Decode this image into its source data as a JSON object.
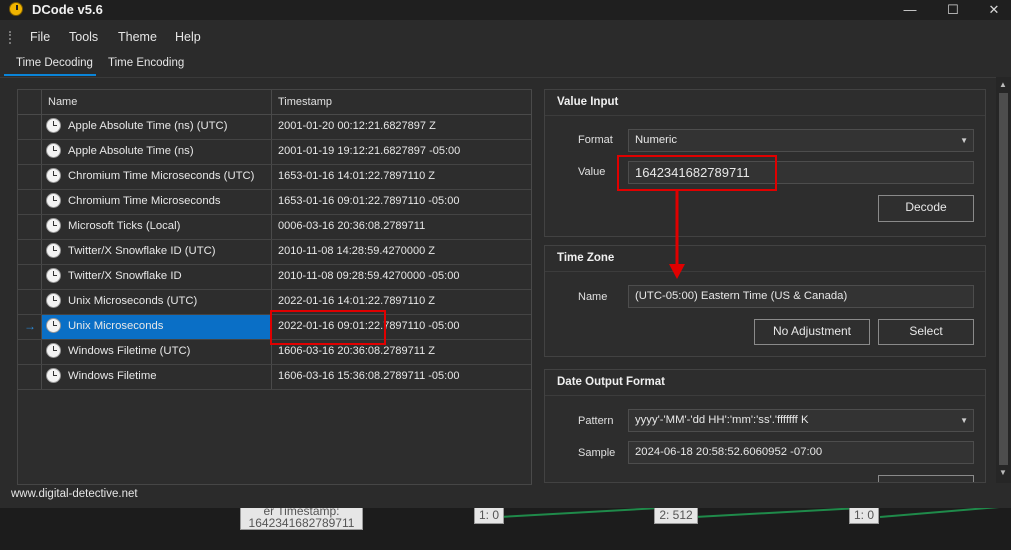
{
  "window": {
    "title": "DCode v5.6",
    "controls": {
      "minimize": "—",
      "maximize": "☐",
      "close": "✕"
    }
  },
  "menu": [
    "File",
    "Tools",
    "Theme",
    "Help"
  ],
  "tabs": [
    {
      "label": "Time Decoding",
      "active": true
    },
    {
      "label": "Time Encoding",
      "active": false
    }
  ],
  "grid": {
    "columns": [
      "Name",
      "Timestamp"
    ],
    "rows": [
      {
        "name": "Apple Absolute Time (ns) (UTC)",
        "timestamp": "2001-01-20 00:12:21.6827897 Z"
      },
      {
        "name": "Apple Absolute Time (ns)",
        "timestamp": "2001-01-19 19:12:21.6827897 -05:00"
      },
      {
        "name": "Chromium Time Microseconds (UTC)",
        "timestamp": "1653-01-16 14:01:22.7897110 Z"
      },
      {
        "name": "Chromium Time Microseconds",
        "timestamp": "1653-01-16 09:01:22.7897110 -05:00"
      },
      {
        "name": "Microsoft Ticks (Local)",
        "timestamp": "0006-03-16 20:36:08.2789711"
      },
      {
        "name": "Twitter/X Snowflake ID (UTC)",
        "timestamp": "2010-11-08 14:28:59.4270000 Z"
      },
      {
        "name": "Twitter/X Snowflake ID",
        "timestamp": "2010-11-08 09:28:59.4270000 -05:00"
      },
      {
        "name": "Unix Microseconds (UTC)",
        "timestamp": "2022-01-16 14:01:22.7897110 Z"
      },
      {
        "name": "Unix Microseconds",
        "timestamp": "2022-01-16 09:01:22.7897110 -05:00",
        "selected": true
      },
      {
        "name": "Windows Filetime (UTC)",
        "timestamp": "1606-03-16 20:36:08.2789711 Z"
      },
      {
        "name": "Windows Filetime",
        "timestamp": "1606-03-16 15:36:08.2789711 -05:00"
      }
    ],
    "selected_indicator": "→"
  },
  "value_input": {
    "title": "Value Input",
    "format_label": "Format",
    "format_value": "Numeric",
    "value_label": "Value",
    "value": "1642341682789711",
    "decode_button": "Decode"
  },
  "time_zone": {
    "title": "Time Zone",
    "name_label": "Name",
    "name_value": "(UTC-05:00) Eastern Time (US & Canada)",
    "no_adjustment_button": "No Adjustment",
    "select_button": "Select"
  },
  "date_output": {
    "title": "Date Output Format",
    "pattern_label": "Pattern",
    "pattern_value": "yyyy'-'MM'-'dd HH':'mm':'ss'.'fffffff K",
    "sample_label": "Sample",
    "sample_value": "2024-06-18 20:58:52.6060952 -07:00"
  },
  "status": {
    "text": "www.digital-detective.net"
  },
  "background_canvas": {
    "node_label": "er Timestamp:",
    "node_value": "1642341682789711",
    "badges": [
      "1: 0",
      "2: 512",
      "1: 0"
    ]
  },
  "colors": {
    "accent": "#0a84d8",
    "selection": "#0a6fc6",
    "annotation": "#e00000",
    "connector": "#1f8a4a"
  }
}
